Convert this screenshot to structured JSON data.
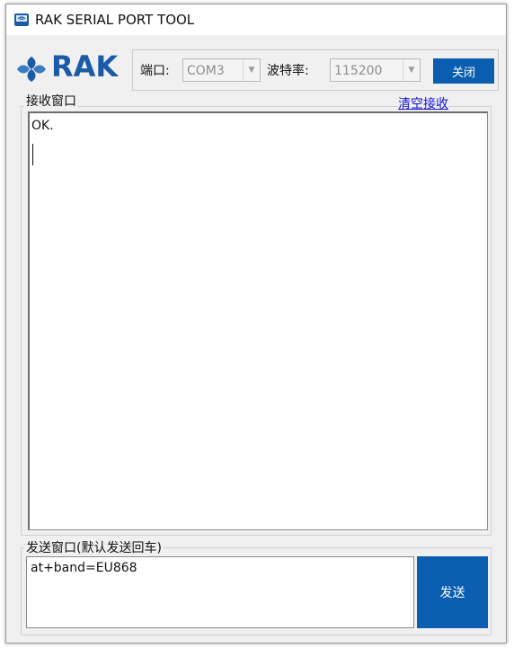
{
  "window": {
    "title": "RAK SERIAL PORT TOOL"
  },
  "logo": {
    "text": "RAK"
  },
  "port_settings": {
    "port_label": "端口:",
    "port_value": "COM3",
    "baud_label": "波特率:",
    "baud_value": "115200",
    "close_button": "关闭"
  },
  "receive": {
    "group_label": "接收窗口",
    "clear_link": "清空接收",
    "content": "OK."
  },
  "send": {
    "group_label": "发送窗口(默认发送回车)",
    "input_value": "at+band=EU868",
    "send_button": "发送"
  },
  "colors": {
    "accent": "#0b5db0",
    "link": "#1515d6",
    "logo": "#1a5aa6"
  }
}
